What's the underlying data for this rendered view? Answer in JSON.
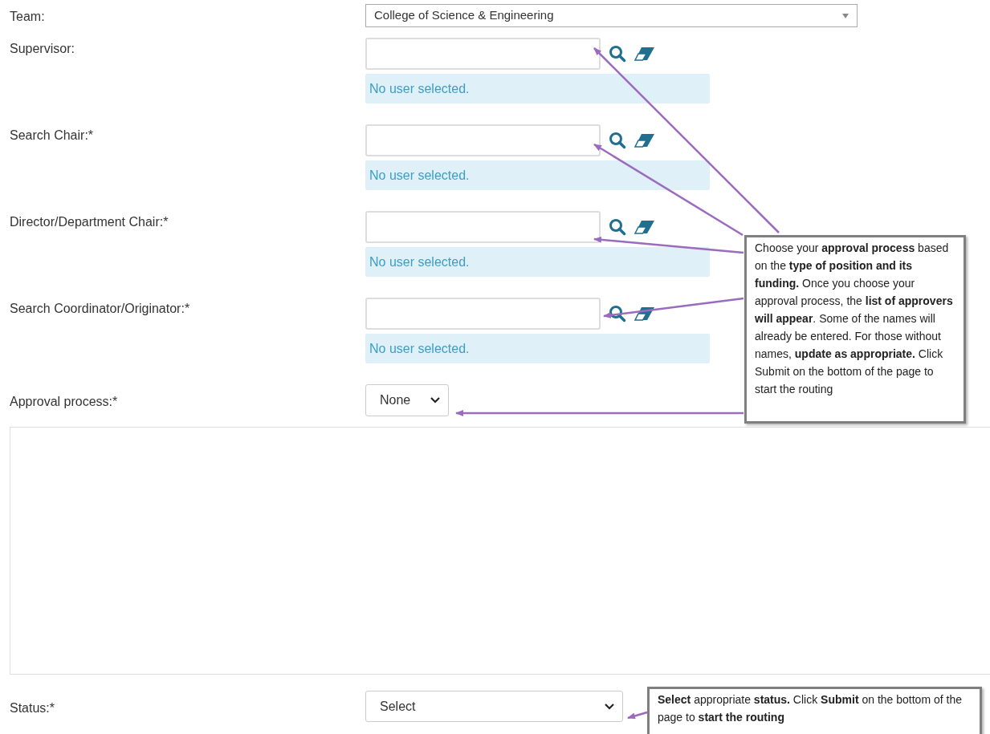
{
  "fields": [
    {
      "kind": "dropdown",
      "label": "Team:",
      "value": "College of Science & Engineering"
    },
    {
      "kind": "lookup",
      "label": "Supervisor:",
      "message": "No user selected."
    },
    {
      "kind": "lookup",
      "label": "Search Chair:*",
      "message": "No user selected."
    },
    {
      "kind": "lookup",
      "label": "Director/Department Chair:*",
      "message": "No user selected."
    },
    {
      "kind": "lookup",
      "label": "Search Coordinator/Originator:*",
      "message": "No user selected."
    },
    {
      "kind": "select",
      "label": "Approval process:*",
      "value": "None"
    },
    {
      "kind": "panel"
    },
    {
      "kind": "wideselect",
      "label": "Status:*",
      "value": "Select"
    }
  ],
  "callouts": [
    {
      "text": "Choose your **approval process** based on the **type of position and its funding.** Once you choose your approval process, the **list of approvers will appear**. Some of the names will already be entered. For those without names, **update as appropriate.** Click Submit on the bottom of the page to start the routing"
    },
    {
      "text": "**Select** appropriate **status.**  Click **Submit** on the bottom of the page to **start the routing**"
    }
  ]
}
